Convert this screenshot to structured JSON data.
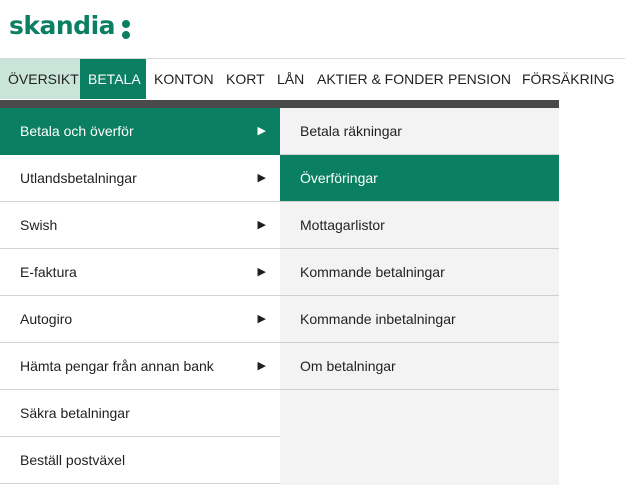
{
  "brand": {
    "name": "skandia",
    "color": "#0b7f61"
  },
  "nav": {
    "items": [
      {
        "label": "ÖVERSIKT",
        "state": "hover"
      },
      {
        "label": "BETALA",
        "state": "active"
      },
      {
        "label": "KONTON",
        "state": ""
      },
      {
        "label": "KORT",
        "state": ""
      },
      {
        "label": "LÅN",
        "state": ""
      },
      {
        "label": "AKTIER & FONDER",
        "state": ""
      },
      {
        "label": "PENSION",
        "state": ""
      },
      {
        "label": "FÖRSÄKRING",
        "state": ""
      }
    ]
  },
  "submenu": {
    "left": [
      {
        "label": "Betala och överför",
        "arrow": "▶",
        "selected": true
      },
      {
        "label": "Utlandsbetalningar",
        "arrow": "▶"
      },
      {
        "label": "Swish",
        "arrow": "▶"
      },
      {
        "label": "E-faktura",
        "arrow": "▶"
      },
      {
        "label": "Autogiro",
        "arrow": "▶"
      },
      {
        "label": "Hämta pengar från annan bank",
        "arrow": "▶"
      },
      {
        "label": "Säkra betalningar"
      },
      {
        "label": "Beställ postväxel"
      }
    ],
    "right": [
      {
        "label": "Betala räkningar"
      },
      {
        "label": "Överföringar",
        "selected": true
      },
      {
        "label": "Mottagarlistor"
      },
      {
        "label": "Kommande betalningar"
      },
      {
        "label": "Kommande inbetalningar"
      },
      {
        "label": "Om betalningar"
      }
    ]
  },
  "colors": {
    "accent": "#0b7f61",
    "nav_hover": "#c9e4d9",
    "submenu_bar": "#4a4a4a",
    "right_panel": "#f3f3f3",
    "divider": "#d2d2d2"
  }
}
